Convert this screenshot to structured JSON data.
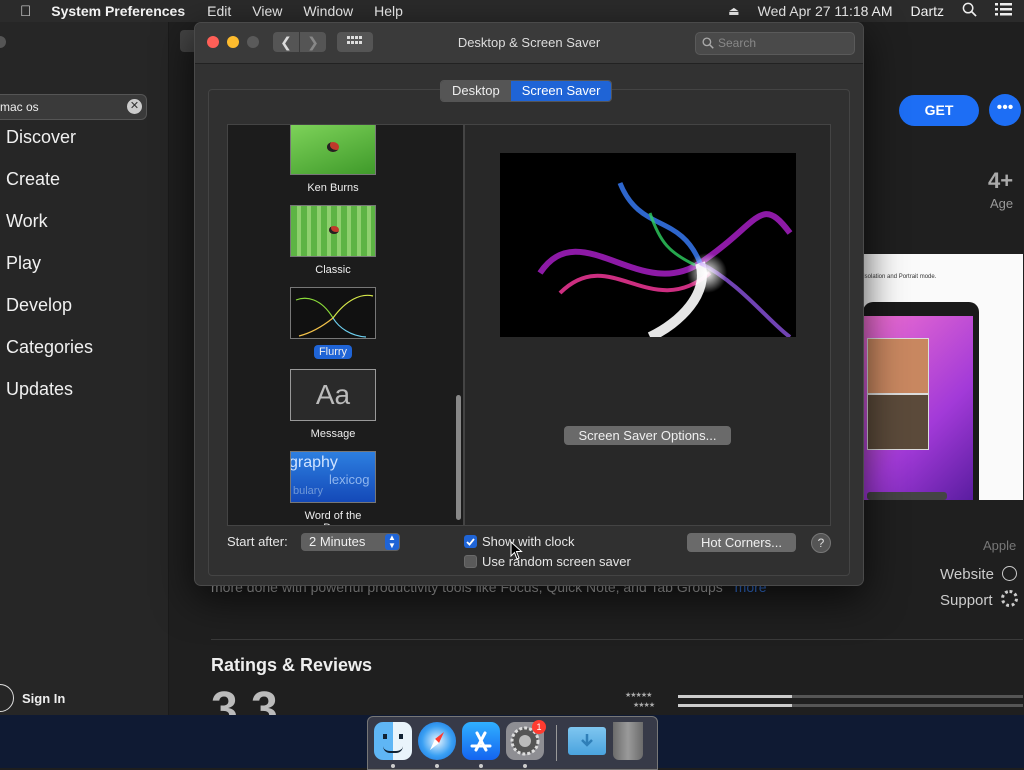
{
  "menubar": {
    "app_name": "System Preferences",
    "menus": [
      "Edit",
      "View",
      "Window",
      "Help"
    ],
    "datetime": "Wed Apr 27  11:18 AM",
    "user": "Dartz"
  },
  "appstore": {
    "search_value": "mac os",
    "sidebar_items": [
      "Discover",
      "Create",
      "Work",
      "Play",
      "Develop",
      "Categories",
      "Updates"
    ],
    "sign_in": "Sign In",
    "get_button": "GET",
    "age_value": "4+",
    "age_label": "Age",
    "developer": "Apple",
    "website": "Website",
    "support": "Support",
    "description": "more done with powerful productivity tools like Focus, Quick Note, and Tab Groups",
    "more": "more",
    "ratings_heading": "Ratings & Reviews",
    "rating_value": "3.3",
    "screenshot_caption": "Isolation and Portrait mode."
  },
  "prefs": {
    "title": "Desktop & Screen Saver",
    "search_placeholder": "Search",
    "tabs": [
      {
        "label": "Desktop",
        "selected": false
      },
      {
        "label": "Screen Saver",
        "selected": true
      }
    ],
    "screen_savers": [
      {
        "label": "Ken Burns",
        "icon": "ladybug-leaf-thumbnail",
        "selected": false
      },
      {
        "label": "Classic",
        "icon": "ladybug-grass-thumbnail",
        "selected": false
      },
      {
        "label": "Flurry",
        "icon": "flurry-thumbnail",
        "selected": true
      },
      {
        "label": "Message",
        "icon": "message-aa-thumbnail",
        "thumb_text": "Aa",
        "selected": false
      },
      {
        "label": "Word of the Day",
        "icon": "word-of-the-day-thumbnail",
        "thumb_words": [
          "graphy",
          "lexicog",
          "bulary"
        ],
        "selected": false
      }
    ],
    "options_button": "Screen Saver Options...",
    "start_after_label": "Start after:",
    "start_after_value": "2 Minutes",
    "show_with_clock": {
      "label": "Show with clock",
      "checked": true
    },
    "random_saver": {
      "label": "Use random screen saver",
      "checked": false
    },
    "hot_corners_button": "Hot Corners...",
    "help_symbol": "?"
  },
  "dock": {
    "apps": [
      "finder-icon",
      "safari-icon",
      "app-store-icon",
      "system-preferences-icon",
      "downloads-folder-icon",
      "trash-icon"
    ],
    "badge": "1"
  },
  "colors": {
    "accent": "#1f64d6",
    "close": "#ff5f57",
    "minimize": "#febc2e",
    "zoom_disabled": "#5a5a5a",
    "get_button": "#1d6ef5"
  }
}
